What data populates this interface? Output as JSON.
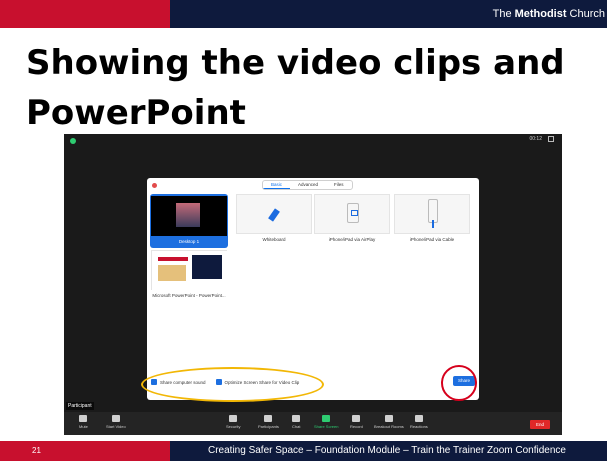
{
  "header": {
    "org_prefix": "The",
    "org_bold": "Methodist",
    "org_suffix": "Church"
  },
  "slide": {
    "title_line1": "Showing the video clips and",
    "title_line2": "PowerPoint"
  },
  "zoom": {
    "timer": "00:12",
    "tabs": [
      {
        "label": "Basic"
      },
      {
        "label": "Advanced"
      },
      {
        "label": "Files"
      }
    ],
    "tiles": [
      {
        "label": "Desktop 1",
        "icon": "desktop-thumbnail"
      },
      {
        "label": "Whiteboard",
        "icon": "pen-icon"
      },
      {
        "label": "iPhone/iPad via AirPlay",
        "icon": "airplay-icon"
      },
      {
        "label": "iPhone/iPad via Cable",
        "icon": "cable-icon"
      },
      {
        "label": "Microsoft PowerPoint - PowerPoint...",
        "icon": "powerpoint-thumbnail"
      }
    ],
    "options": {
      "share_sound": "Share computer sound",
      "optimize": "Optimize Screen Share for Video Clip"
    },
    "share_button": "Share",
    "participant": "Participant",
    "toolbar": [
      {
        "label": "Mute",
        "icon": "microphone-icon"
      },
      {
        "label": "Start Video",
        "icon": "video-icon"
      },
      {
        "label": "Security",
        "icon": "shield-icon"
      },
      {
        "label": "Participants",
        "icon": "participants-icon"
      },
      {
        "label": "Chat",
        "icon": "chat-icon"
      },
      {
        "label": "Share Screen",
        "icon": "share-screen-icon"
      },
      {
        "label": "Record",
        "icon": "record-icon"
      },
      {
        "label": "Breakout Rooms",
        "icon": "breakout-icon"
      },
      {
        "label": "Reactions",
        "icon": "reactions-icon"
      }
    ],
    "end_button": "End"
  },
  "footer": {
    "page": "21",
    "text": "Creating Safer Space – Foundation Module – Train the Trainer Zoom Confidence"
  },
  "colors": {
    "red": "#c8102e",
    "navy": "#0e1a3d",
    "zoom_blue": "#1d6fe0",
    "highlight_yellow": "#f2b705",
    "highlight_red": "#d6001c"
  }
}
